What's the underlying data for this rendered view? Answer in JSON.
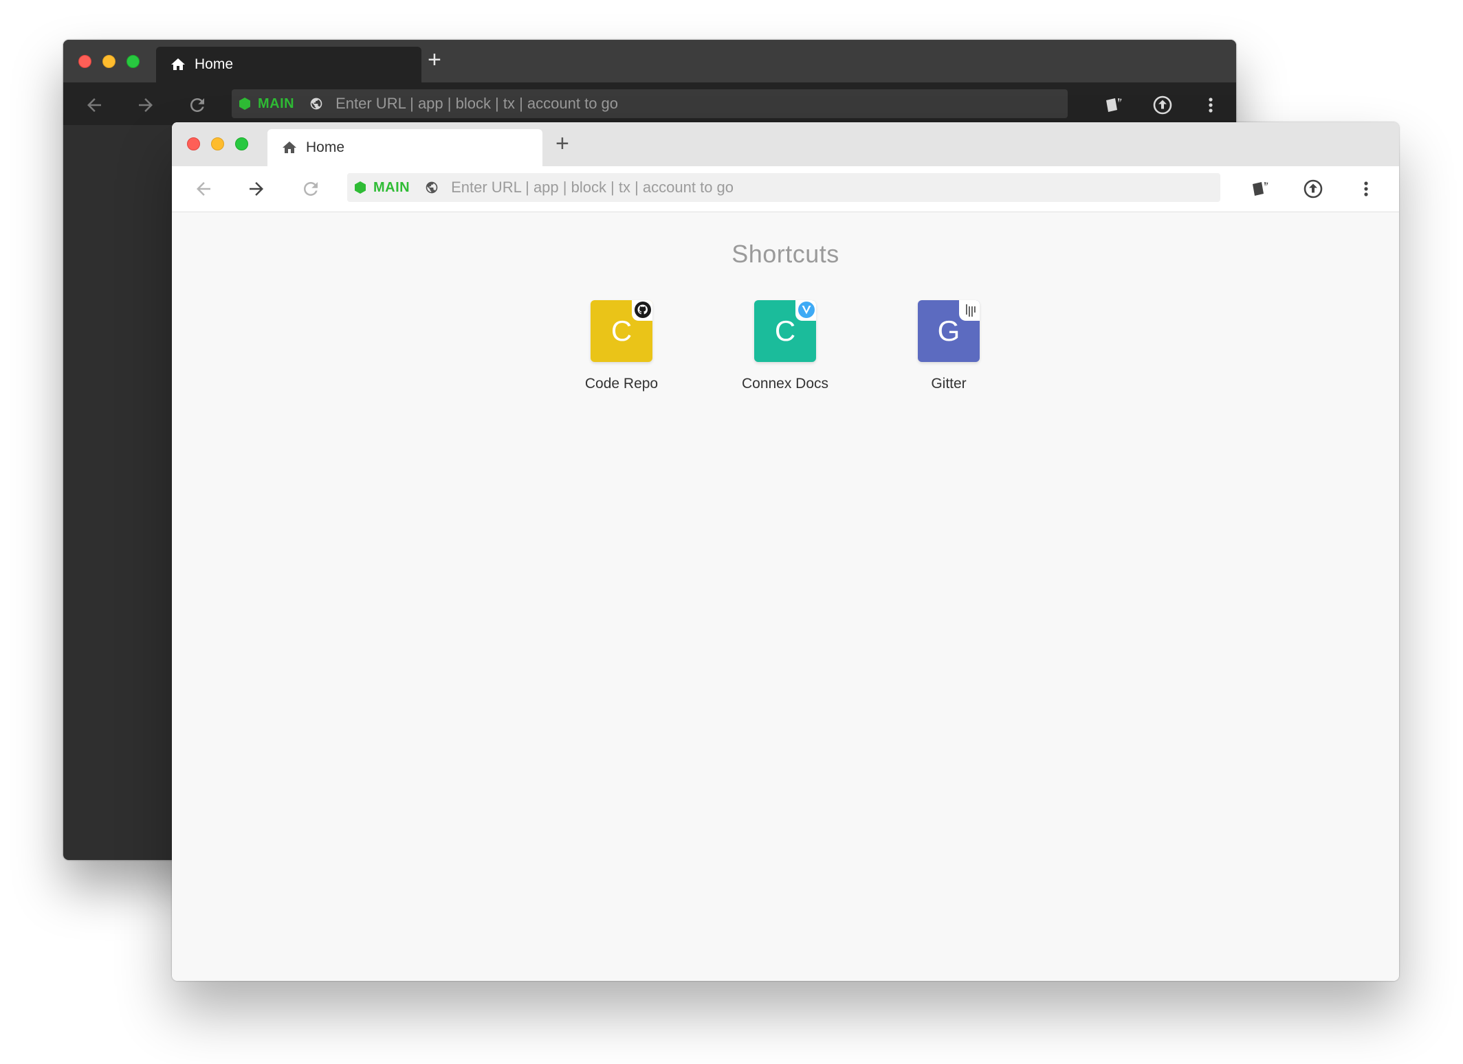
{
  "back_window": {
    "tab": {
      "label": "Home"
    },
    "new_tab_label": "+",
    "network_label": "MAIN",
    "url_placeholder": "Enter URL | app | block | tx | account to go"
  },
  "front_window": {
    "tab": {
      "label": "Home"
    },
    "new_tab_label": "+",
    "network_label": "MAIN",
    "url_placeholder": "Enter URL | app | block | tx | account to go",
    "content": {
      "title": "Shortcuts",
      "shortcuts": [
        {
          "letter": "C",
          "label": "Code Repo",
          "color": "#eac418",
          "badge_icon": "github-icon"
        },
        {
          "letter": "C",
          "label": "Connex Docs",
          "color": "#1bbc9b",
          "badge_icon": "vuepress-icon"
        },
        {
          "letter": "G",
          "label": "Gitter",
          "color": "#5c6bc0",
          "badge_icon": "gitter-icon"
        }
      ]
    }
  },
  "colors": {
    "network_green": "#2fbc35",
    "close": "#fe5f57",
    "minimize": "#febc2e",
    "zoom": "#28c840"
  }
}
